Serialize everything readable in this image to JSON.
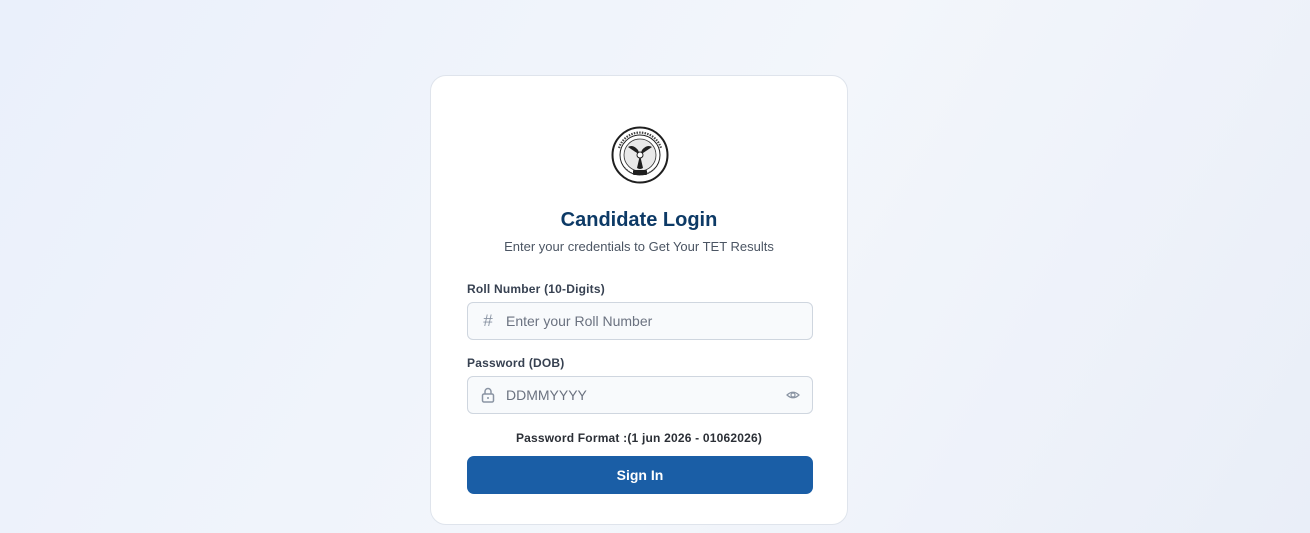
{
  "login": {
    "title": "Candidate Login",
    "subtitle": "Enter your credentials to Get Your TET Results",
    "roll": {
      "label": "Roll Number (10-Digits)",
      "placeholder": "Enter your Roll Number",
      "value": "",
      "icon": "hash-icon"
    },
    "password": {
      "label": "Password (DOB)",
      "placeholder": "DDMMYYYY",
      "value": "",
      "icon": "lock-icon",
      "toggle_icon": "eye-icon"
    },
    "format_hint": "Password Format :(1 jun 2026 - 01062026)",
    "submit_label": "Sign In"
  },
  "colors": {
    "title": "#0d3a66",
    "button": "#1a5ea6",
    "field_bg": "#f8fafc",
    "field_border": "#cfd6df"
  }
}
